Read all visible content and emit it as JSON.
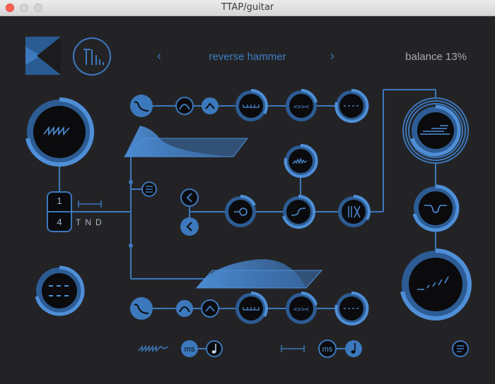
{
  "window": {
    "title": "TTAP/guitar"
  },
  "header": {
    "preset_name": "reverse hammer",
    "prev_arrow": "‹",
    "next_arrow": "›",
    "balance_label": "balance 13%"
  },
  "ratio": {
    "numerator": "1",
    "denominator": "4"
  },
  "timing_modes": [
    "T",
    "N",
    "D"
  ],
  "footer": {
    "ms_left": "ms",
    "ms_right": "ms"
  },
  "colors": {
    "accent": "#3c78bc",
    "accent_light": "#5a9ae0",
    "bg": "#232326",
    "knob_bg": "#0b0b0d"
  }
}
